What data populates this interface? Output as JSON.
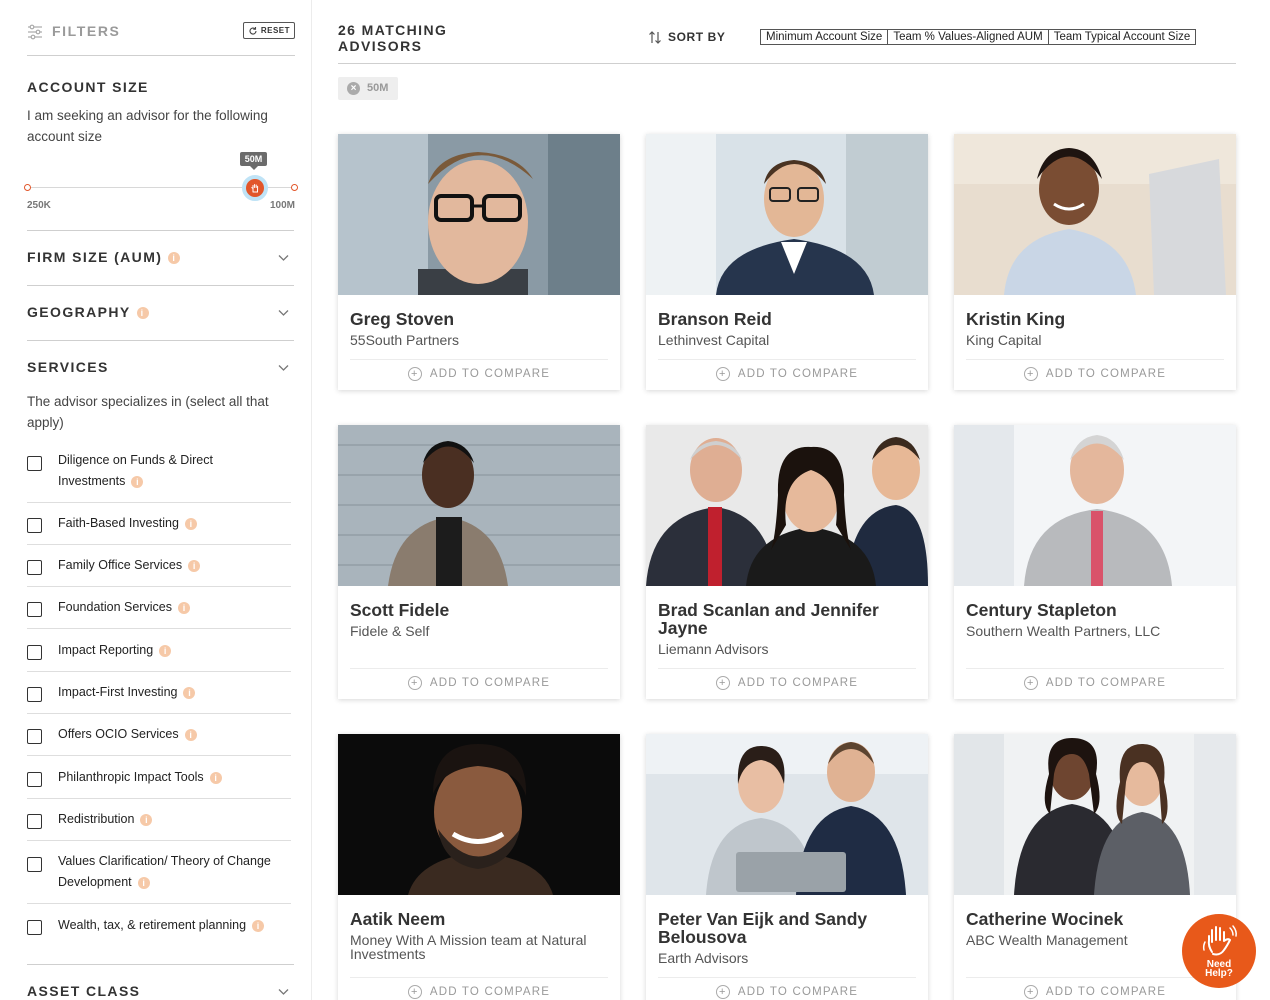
{
  "sidebar": {
    "filters_title": "FILTERS",
    "reset_label": "RESET",
    "account_size": {
      "title": "ACCOUNT SIZE",
      "description": "I am seeking an advisor for the following account size",
      "min_label": "250K",
      "max_label": "100M",
      "value_label": "50M",
      "slider_fraction": 0.85
    },
    "firm_size_title": "FIRM SIZE (AUM)",
    "geography_title": "GEOGRAPHY",
    "services": {
      "title": "SERVICES",
      "description": "The advisor specializes in (select all that apply)",
      "items": [
        {
          "label": "Diligence on Funds & Direct Investments"
        },
        {
          "label": "Faith-Based Investing"
        },
        {
          "label": "Family Office Services"
        },
        {
          "label": "Foundation Services"
        },
        {
          "label": "Impact Reporting"
        },
        {
          "label": "Impact-First Investing"
        },
        {
          "label": "Offers OCIO Services"
        },
        {
          "label": "Philanthropic Impact Tools"
        },
        {
          "label": "Redistribution"
        },
        {
          "label": "Values Clarification/ Theory of Change Development"
        },
        {
          "label": "Wealth, tax, & retirement planning"
        }
      ]
    },
    "asset_class_title": "ASSET CLASS"
  },
  "main": {
    "count_label": "26 MATCHING ADVISORS",
    "sort_label": "SORT BY",
    "sort_options": [
      "Minimum Account Size",
      "Team % Values-Aligned AUM",
      "Team Typical Account Size"
    ],
    "active_filter_chip": "50M",
    "compare_label": "ADD TO COMPARE",
    "advisors": [
      {
        "name": "Greg Stoven",
        "firm": "55South Partners"
      },
      {
        "name": "Branson Reid",
        "firm": "Lethinvest Capital"
      },
      {
        "name": "Kristin King",
        "firm": "King Capital"
      },
      {
        "name": "Scott Fidele",
        "firm": "Fidele & Self"
      },
      {
        "name": "Brad Scanlan and Jennifer Jayne",
        "firm": "Liemann Advisors"
      },
      {
        "name": "Century Stapleton",
        "firm": "Southern Wealth Partners, LLC"
      },
      {
        "name": "Aatik Neem",
        "firm": "Money With A Mission team at Natural Investments"
      },
      {
        "name": "Peter Van Eijk and Sandy Belousova",
        "firm": "Earth Advisors"
      },
      {
        "name": "Catherine Wocinek",
        "firm": "ABC Wealth Management"
      }
    ]
  },
  "help_button": {
    "label_line1": "Need",
    "label_line2": "Help?"
  },
  "colors": {
    "accent": "#e2562a",
    "info_dot": "#f6c9a8",
    "help": "#e8591a"
  }
}
